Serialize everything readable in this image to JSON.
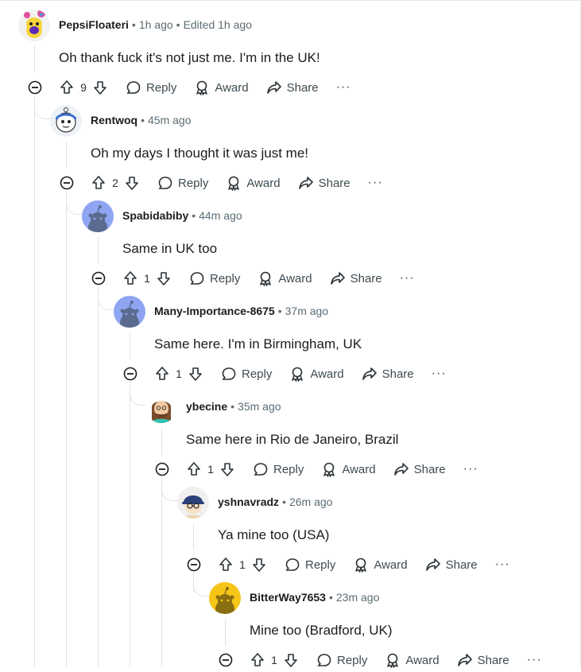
{
  "comments": [
    {
      "username": "PepsiFloateri",
      "time": "1h ago",
      "edited": "Edited 1h ago",
      "body": "Oh thank fuck it's not just me. I'm in the UK!",
      "votes": "9",
      "reply_label": "Reply",
      "award_label": "Award",
      "share_label": "Share",
      "avatar_icon": "purple-snoo-avatar-icon"
    },
    {
      "username": "Rentwoq",
      "time": "45m ago",
      "body": "Oh my days I thought it was just me!",
      "votes": "2",
      "reply_label": "Reply",
      "award_label": "Award",
      "share_label": "Share",
      "avatar_icon": "white-snoo-avatar-icon"
    },
    {
      "username": "Spabidabiby",
      "time": "44m ago",
      "body": "Same in UK too",
      "votes": "1",
      "reply_label": "Reply",
      "award_label": "Award",
      "share_label": "Share",
      "avatar_icon": "default-snoo-avatar-icon"
    },
    {
      "username": "Many-Importance-8675",
      "time": "37m ago",
      "body": "Same here. I'm in Birmingham, UK",
      "votes": "1",
      "reply_label": "Reply",
      "award_label": "Award",
      "share_label": "Share",
      "avatar_icon": "default-snoo-avatar-icon"
    },
    {
      "username": "ybecine",
      "time": "35m ago",
      "body": "Same here in Rio de Janeiro, Brazil",
      "votes": "1",
      "reply_label": "Reply",
      "award_label": "Award",
      "share_label": "Share",
      "avatar_icon": "bearded-snoo-avatar-icon"
    },
    {
      "username": "yshnavradz",
      "time": "26m ago",
      "body": "Ya mine too (USA)",
      "votes": "1",
      "reply_label": "Reply",
      "award_label": "Award",
      "share_label": "Share",
      "avatar_icon": "cap-snoo-avatar-icon"
    },
    {
      "username": "BitterWay7653",
      "time": "23m ago",
      "body": "Mine too (Bradford, UK)",
      "votes": "1",
      "reply_label": "Reply",
      "award_label": "Award",
      "share_label": "Share",
      "avatar_icon": "yellow-snoo-avatar-icon"
    }
  ],
  "colors": {
    "default_avatar": "#8fa5f2",
    "yellow_avatar": "#f5c518",
    "meta_text": "#5c6c74",
    "action_text": "#3f4b52"
  }
}
